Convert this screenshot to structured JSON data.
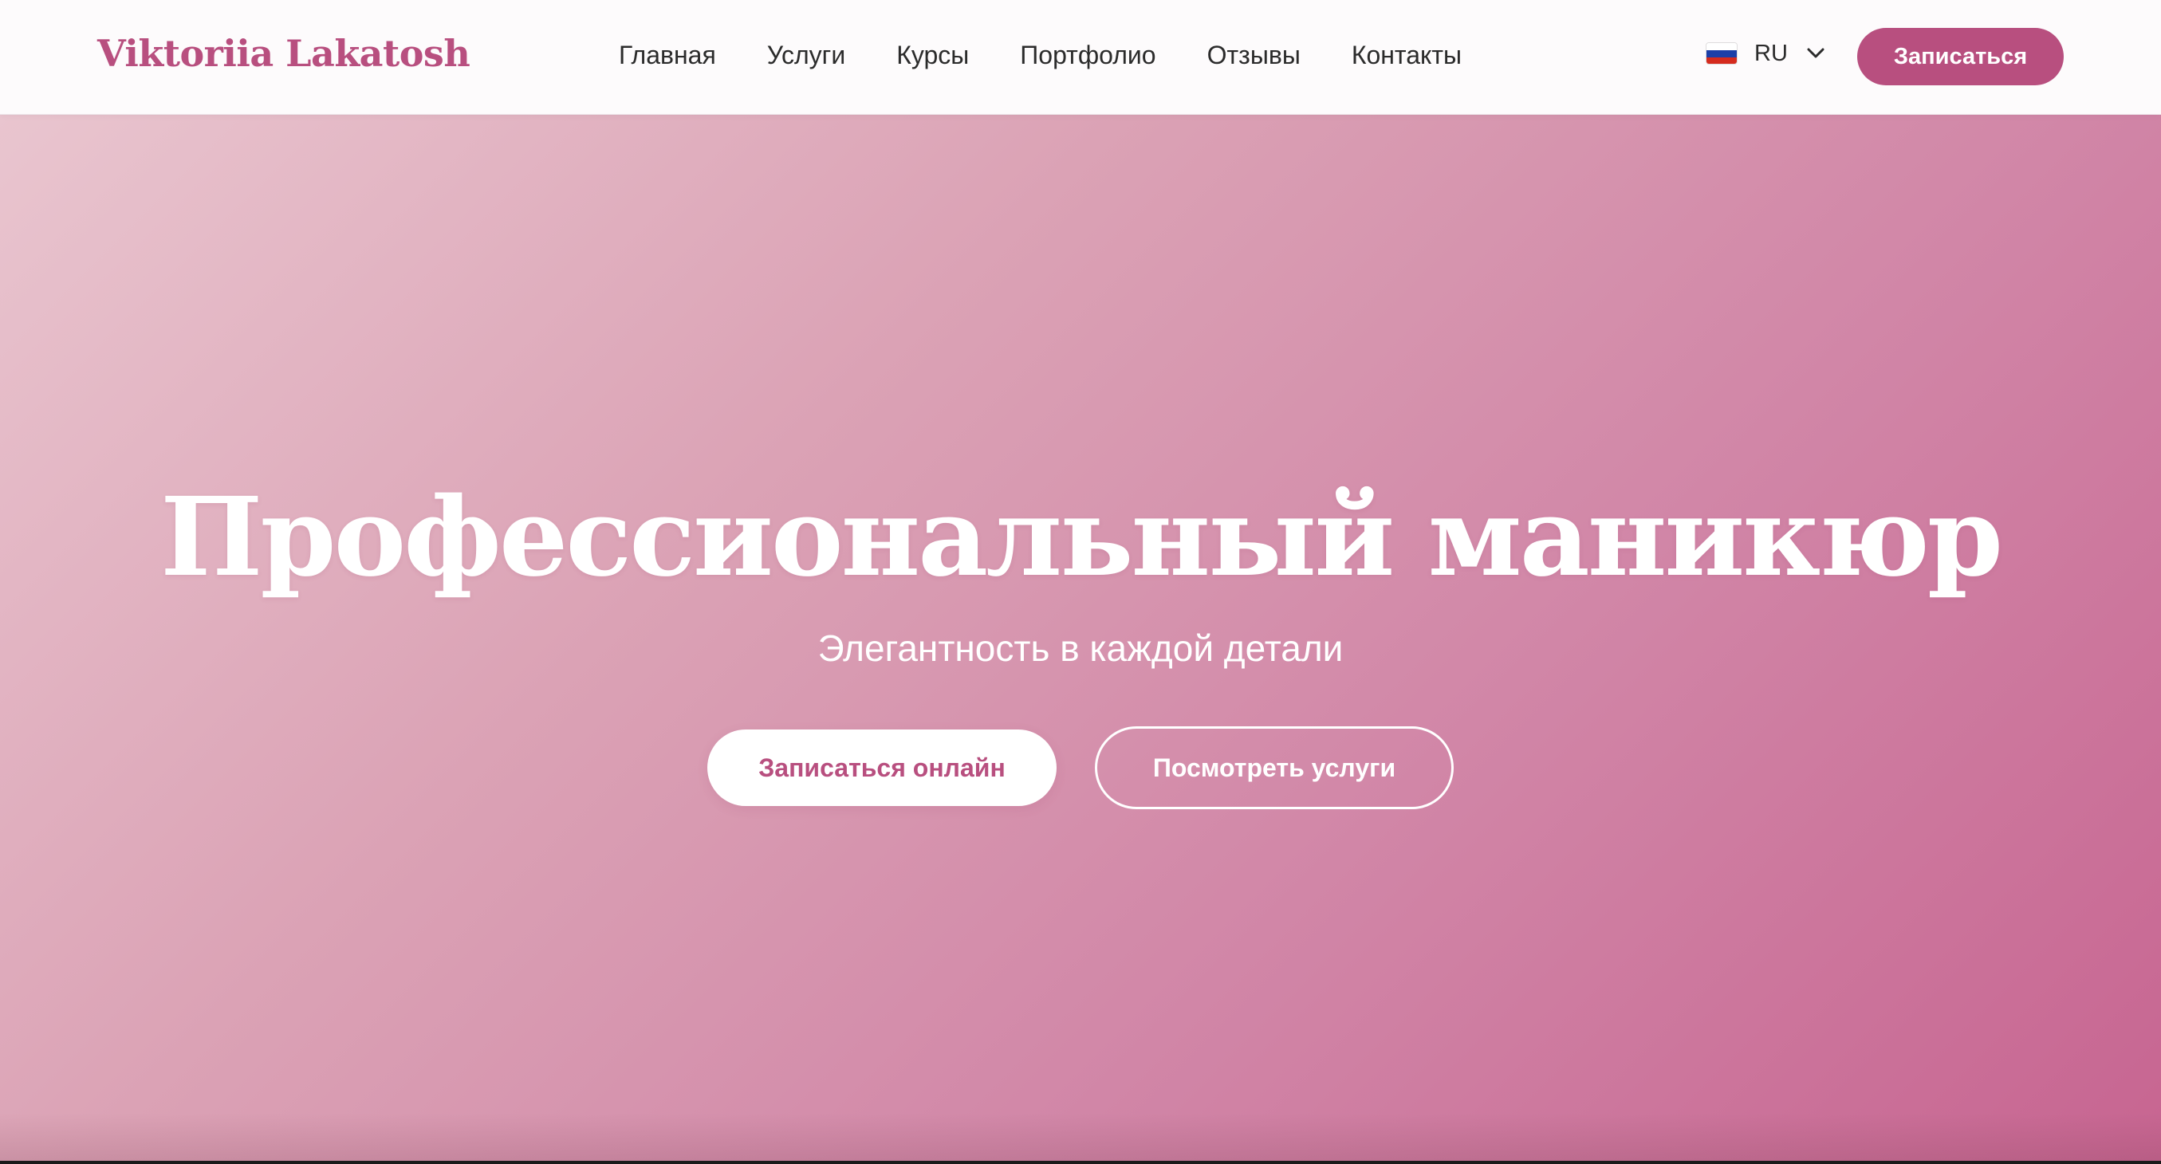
{
  "header": {
    "logo": "Viktoriia Lakatosh",
    "nav": [
      {
        "label": "Главная"
      },
      {
        "label": "Услуги"
      },
      {
        "label": "Курсы"
      },
      {
        "label": "Портфолио"
      },
      {
        "label": "Отзывы"
      },
      {
        "label": "Контакты"
      }
    ],
    "language": {
      "code": "RU",
      "flag_icon": "russian-flag-icon",
      "flag_colors": [
        "#ffffff",
        "#1c3fa8",
        "#d52b1e"
      ],
      "chevron_icon": "chevron-down-icon"
    },
    "cta_label": "Записаться"
  },
  "hero": {
    "title": "Профессиональный маникюр",
    "subtitle": "Элегантность в каждой детали",
    "primary_button": "Записаться онлайн",
    "secondary_button": "Посмотреть услуги"
  },
  "colors": {
    "accent": "#b84f7f",
    "hero_gradient_start": "#e9c5cf",
    "hero_gradient_end": "#c76591",
    "text_dark": "#2b2b2b"
  }
}
